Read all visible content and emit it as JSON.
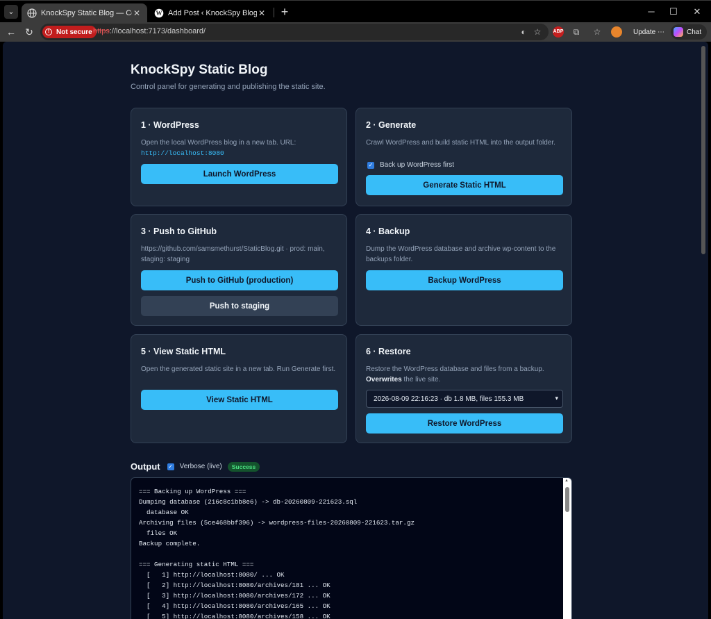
{
  "browser": {
    "tabs": [
      {
        "title": "KnockSpy Static Blog — Control Pa",
        "active": true
      },
      {
        "title": "Add Post ‹ KnockSpy Blog — Word",
        "active": false
      }
    ],
    "not_secure_label": "Not secure",
    "url_protocol": "https",
    "url_rest": "://localhost:7173/dashboard/",
    "update_label": "Update",
    "chat_label": "Chat"
  },
  "page": {
    "title": "KnockSpy Static Blog",
    "subtitle": "Control panel for generating and publishing the static site."
  },
  "cards": {
    "wordpress": {
      "title": "1 · WordPress",
      "desc": "Open the local WordPress blog in a new tab. URL:",
      "url": "http://localhost:8080",
      "button": "Launch WordPress"
    },
    "generate": {
      "title": "2 · Generate",
      "desc": "Crawl WordPress and build static HTML into the output folder.",
      "checkbox_label": "Back up WordPress first",
      "checkbox_checked": true,
      "button": "Generate Static HTML"
    },
    "github": {
      "title": "3 · Push to GitHub",
      "desc": "https://github.com/samsmethurst/StaticBlog.git · prod: main, staging: staging",
      "button_primary": "Push to GitHub (production)",
      "button_secondary": "Push to staging"
    },
    "backup": {
      "title": "4 · Backup",
      "desc": "Dump the WordPress database and archive wp-content to the backups folder.",
      "button": "Backup WordPress"
    },
    "view": {
      "title": "5 · View Static HTML",
      "desc": "Open the generated static site in a new tab. Run Generate first.",
      "button": "View Static HTML"
    },
    "restore": {
      "title": "6 · Restore",
      "desc": "Restore the WordPress database and files from a backup.",
      "desc_bold": "Overwrites",
      "desc_tail": " the live site.",
      "selected_backup": "2026-08-09 22:16:23 · db 1.8 MB, files 155.3 MB",
      "button": "Restore WordPress"
    }
  },
  "output": {
    "label": "Output",
    "verbose_label": "Verbose (live)",
    "verbose_checked": true,
    "status_badge": "Success",
    "log": "=== Backing up WordPress ===\nDumping database (216c8c1bb8e6) -> db-20260809-221623.sql\n  database OK\nArchiving files (5ce468bbf396) -> wordpress-files-20260809-221623.tar.gz\n  files OK\nBackup complete.\n\n=== Generating static HTML ===\n  [   1] http://localhost:8080/ ... OK\n  [   2] http://localhost:8080/archives/181 ... OK\n  [   3] http://localhost:8080/archives/172 ... OK\n  [   4] http://localhost:8080/archives/165 ... OK\n  [   5] http://localhost:8080/archives/158 ... OK"
  }
}
